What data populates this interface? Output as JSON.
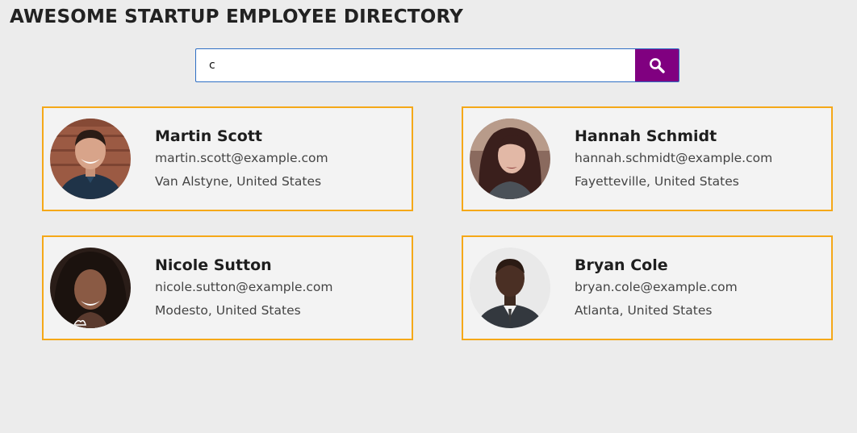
{
  "header": {
    "title": "AWESOME STARTUP EMPLOYEE DIRECTORY"
  },
  "search": {
    "value": "c",
    "button_icon": "search-icon",
    "button_color": "#800080"
  },
  "colors": {
    "card_border": "#f5a818",
    "input_border": "#2f6fc4"
  },
  "employees": [
    {
      "name": "Martin Scott",
      "email": "martin.scott@example.com",
      "location": "Van Alstyne, United States"
    },
    {
      "name": "Hannah Schmidt",
      "email": "hannah.schmidt@example.com",
      "location": "Fayetteville, United States"
    },
    {
      "name": "Nicole Sutton",
      "email": "nicole.sutton@example.com",
      "location": "Modesto, United States"
    },
    {
      "name": "Bryan Cole",
      "email": "bryan.cole@example.com",
      "location": "Atlanta, United States"
    }
  ]
}
